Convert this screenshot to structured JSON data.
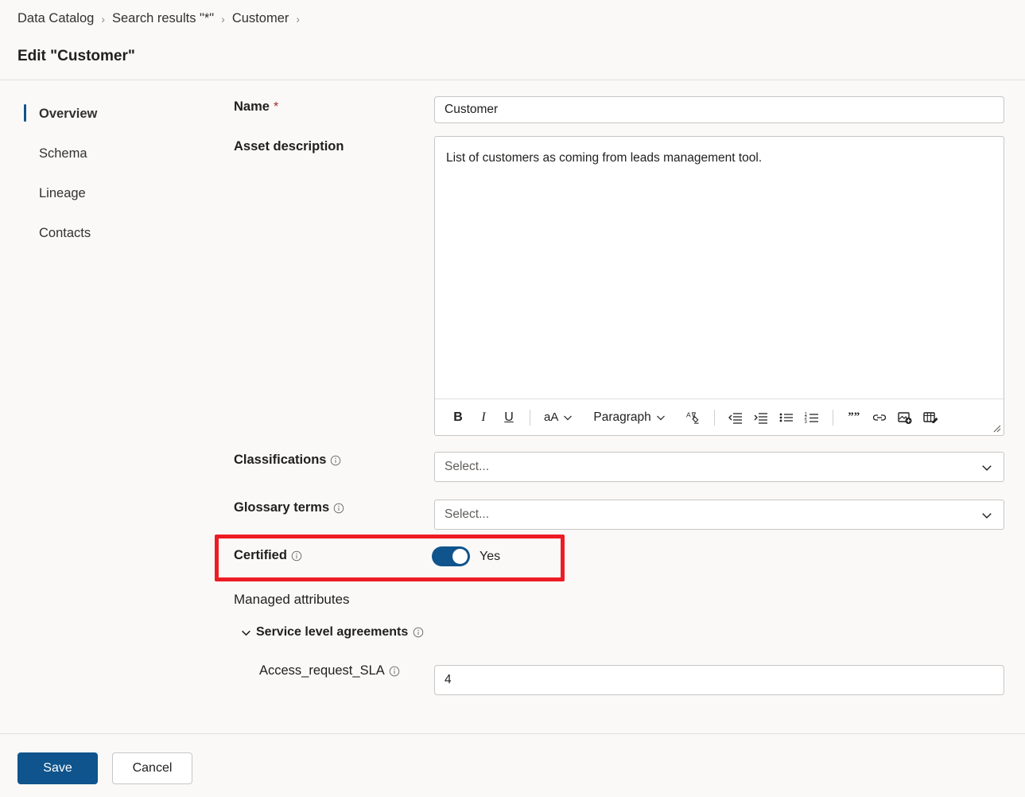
{
  "header": {
    "breadcrumb": [
      {
        "label": "Data Catalog"
      },
      {
        "label": "Search results \"*\""
      },
      {
        "label": "Customer"
      }
    ],
    "separator": "›",
    "title": "Edit \"Customer\""
  },
  "sidebar": {
    "items": [
      {
        "label": "Overview",
        "active": true
      },
      {
        "label": "Schema",
        "active": false
      },
      {
        "label": "Lineage",
        "active": false
      },
      {
        "label": "Contacts",
        "active": false
      }
    ]
  },
  "form": {
    "name": {
      "label": "Name",
      "required_mark": "*",
      "value": "Customer"
    },
    "asset_description": {
      "label": "Asset description",
      "value": "List of customers as coming from leads management tool.",
      "toolbar": {
        "bold": "B",
        "italic": "I",
        "underline": "U",
        "font_size": "aA",
        "paragraph": "Paragraph",
        "clear_formatting": "clear-formatting",
        "outdent": "outdent",
        "indent": "indent",
        "bulleted_list": "bulleted-list",
        "numbered_list": "numbered-list",
        "quote": "””",
        "link": "link",
        "image": "insert-image",
        "table": "insert-table"
      }
    },
    "classifications": {
      "label": "Classifications",
      "placeholder": "Select...",
      "has_info": true
    },
    "glossary_terms": {
      "label": "Glossary terms",
      "placeholder": "Select...",
      "has_info": true
    },
    "certified": {
      "label": "Certified",
      "state_label": "Yes",
      "checked": true,
      "has_info": true,
      "highlighted": true
    },
    "managed_attributes": {
      "heading": "Managed attributes",
      "groups": [
        {
          "title": "Service level agreements",
          "expanded": true,
          "has_info": true,
          "attributes": [
            {
              "label": "Access_request_SLA",
              "value": "4",
              "has_info": true
            }
          ]
        }
      ]
    }
  },
  "footer": {
    "save_label": "Save",
    "cancel_label": "Cancel"
  },
  "colors": {
    "accent": "#0f548c",
    "toggle_on": "#0f548c",
    "highlight_box": "#ed1c24",
    "required": "#a4262c",
    "page_background": "#faf9f8",
    "field_border": "#c8c6c4"
  }
}
